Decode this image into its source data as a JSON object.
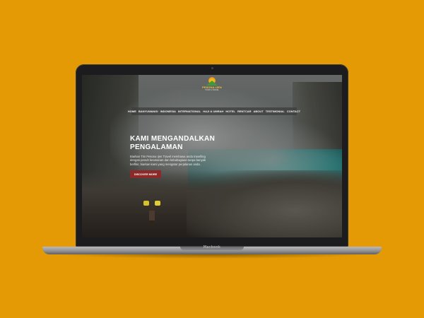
{
  "device": {
    "brand_label": "Macbook"
  },
  "site": {
    "logo": {
      "name": "PESONA IJEN",
      "tagline": "TOUR & TRAVEL"
    },
    "nav": [
      "HOME",
      "BANYUWANGI",
      "INDONESIA",
      "INTERNATIONAL",
      "HAJI & UMRAH",
      "HOTEL",
      "RENTCAR",
      "ABOUT",
      "TESTIMONIAL",
      "CONTACT"
    ],
    "hero": {
      "title_line1": "KAMI MENGANDALKAN",
      "title_line2": "PENGALAMAN",
      "text": "Biarkan Tim Pesona Ijen Travel membawa anda travelling dengan penuh keamanan dan kebahagiaan tanpa banyak berfikir, biarkan kami yang mengatur perjalanan anda.",
      "button": "DISCOVER MORE"
    }
  }
}
